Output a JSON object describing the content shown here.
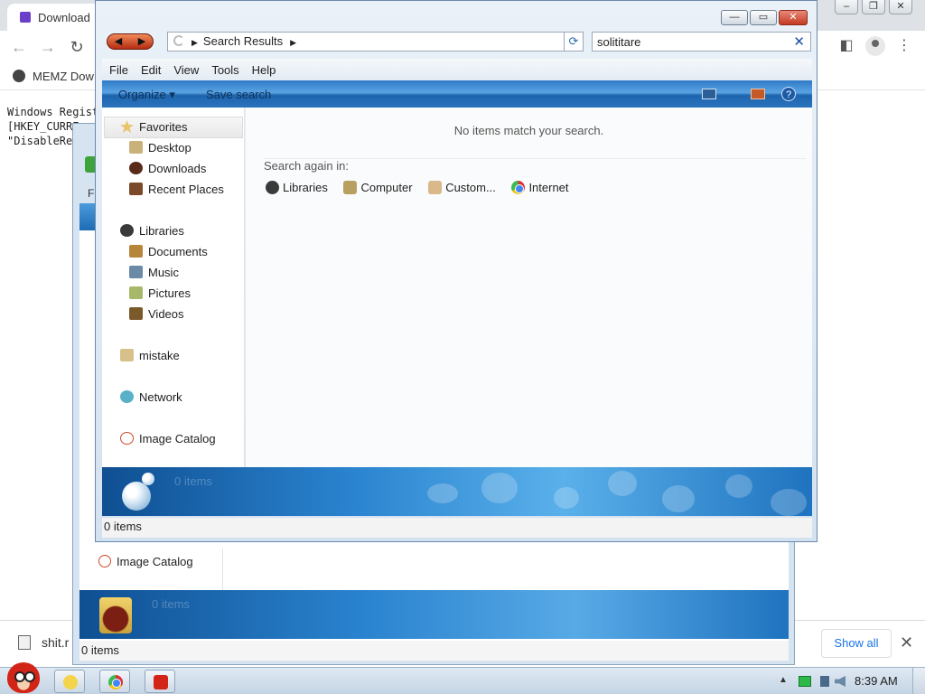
{
  "browser": {
    "tab_title": "Download",
    "bookmark": "MEMZ Dow",
    "content_lines": [
      "Windows Regist",
      "[HKEY_CURRE",
      "\"DisableRe"
    ],
    "download_file": "shit.r",
    "show_all_label": "Show all"
  },
  "back_window": {
    "nav_item": "Image Catalog",
    "details_count": "0 items",
    "status_text": "0 items",
    "menu_letter": "F"
  },
  "window": {
    "address": "Search Results",
    "search_value": "solititare",
    "menu": [
      "File",
      "Edit",
      "View",
      "Tools",
      "Help"
    ],
    "toolbar": {
      "organize": "Organize",
      "save_search": "Save search",
      "help_glyph": "?"
    },
    "nav": {
      "favorites": "Favorites",
      "desktop": "Desktop",
      "downloads": "Downloads",
      "recent": "Recent Places",
      "libraries": "Libraries",
      "documents": "Documents",
      "music": "Music",
      "pictures": "Pictures",
      "videos": "Videos",
      "user": "mistake",
      "network": "Network",
      "image_catalog": "Image Catalog"
    },
    "main": {
      "no_match": "No items match your search.",
      "search_again": "Search again in:",
      "options": [
        "Libraries",
        "Computer",
        "Custom...",
        "Internet"
      ]
    },
    "details_count": "0 items",
    "status_text": "0 items"
  },
  "taskbar": {
    "clock": "8:39 AM"
  },
  "colors": {
    "window_frame": "#d3e2f1",
    "command_bar": "#2f7bc7",
    "close_button": "#c43a22",
    "accent_link": "#1a73e8"
  }
}
